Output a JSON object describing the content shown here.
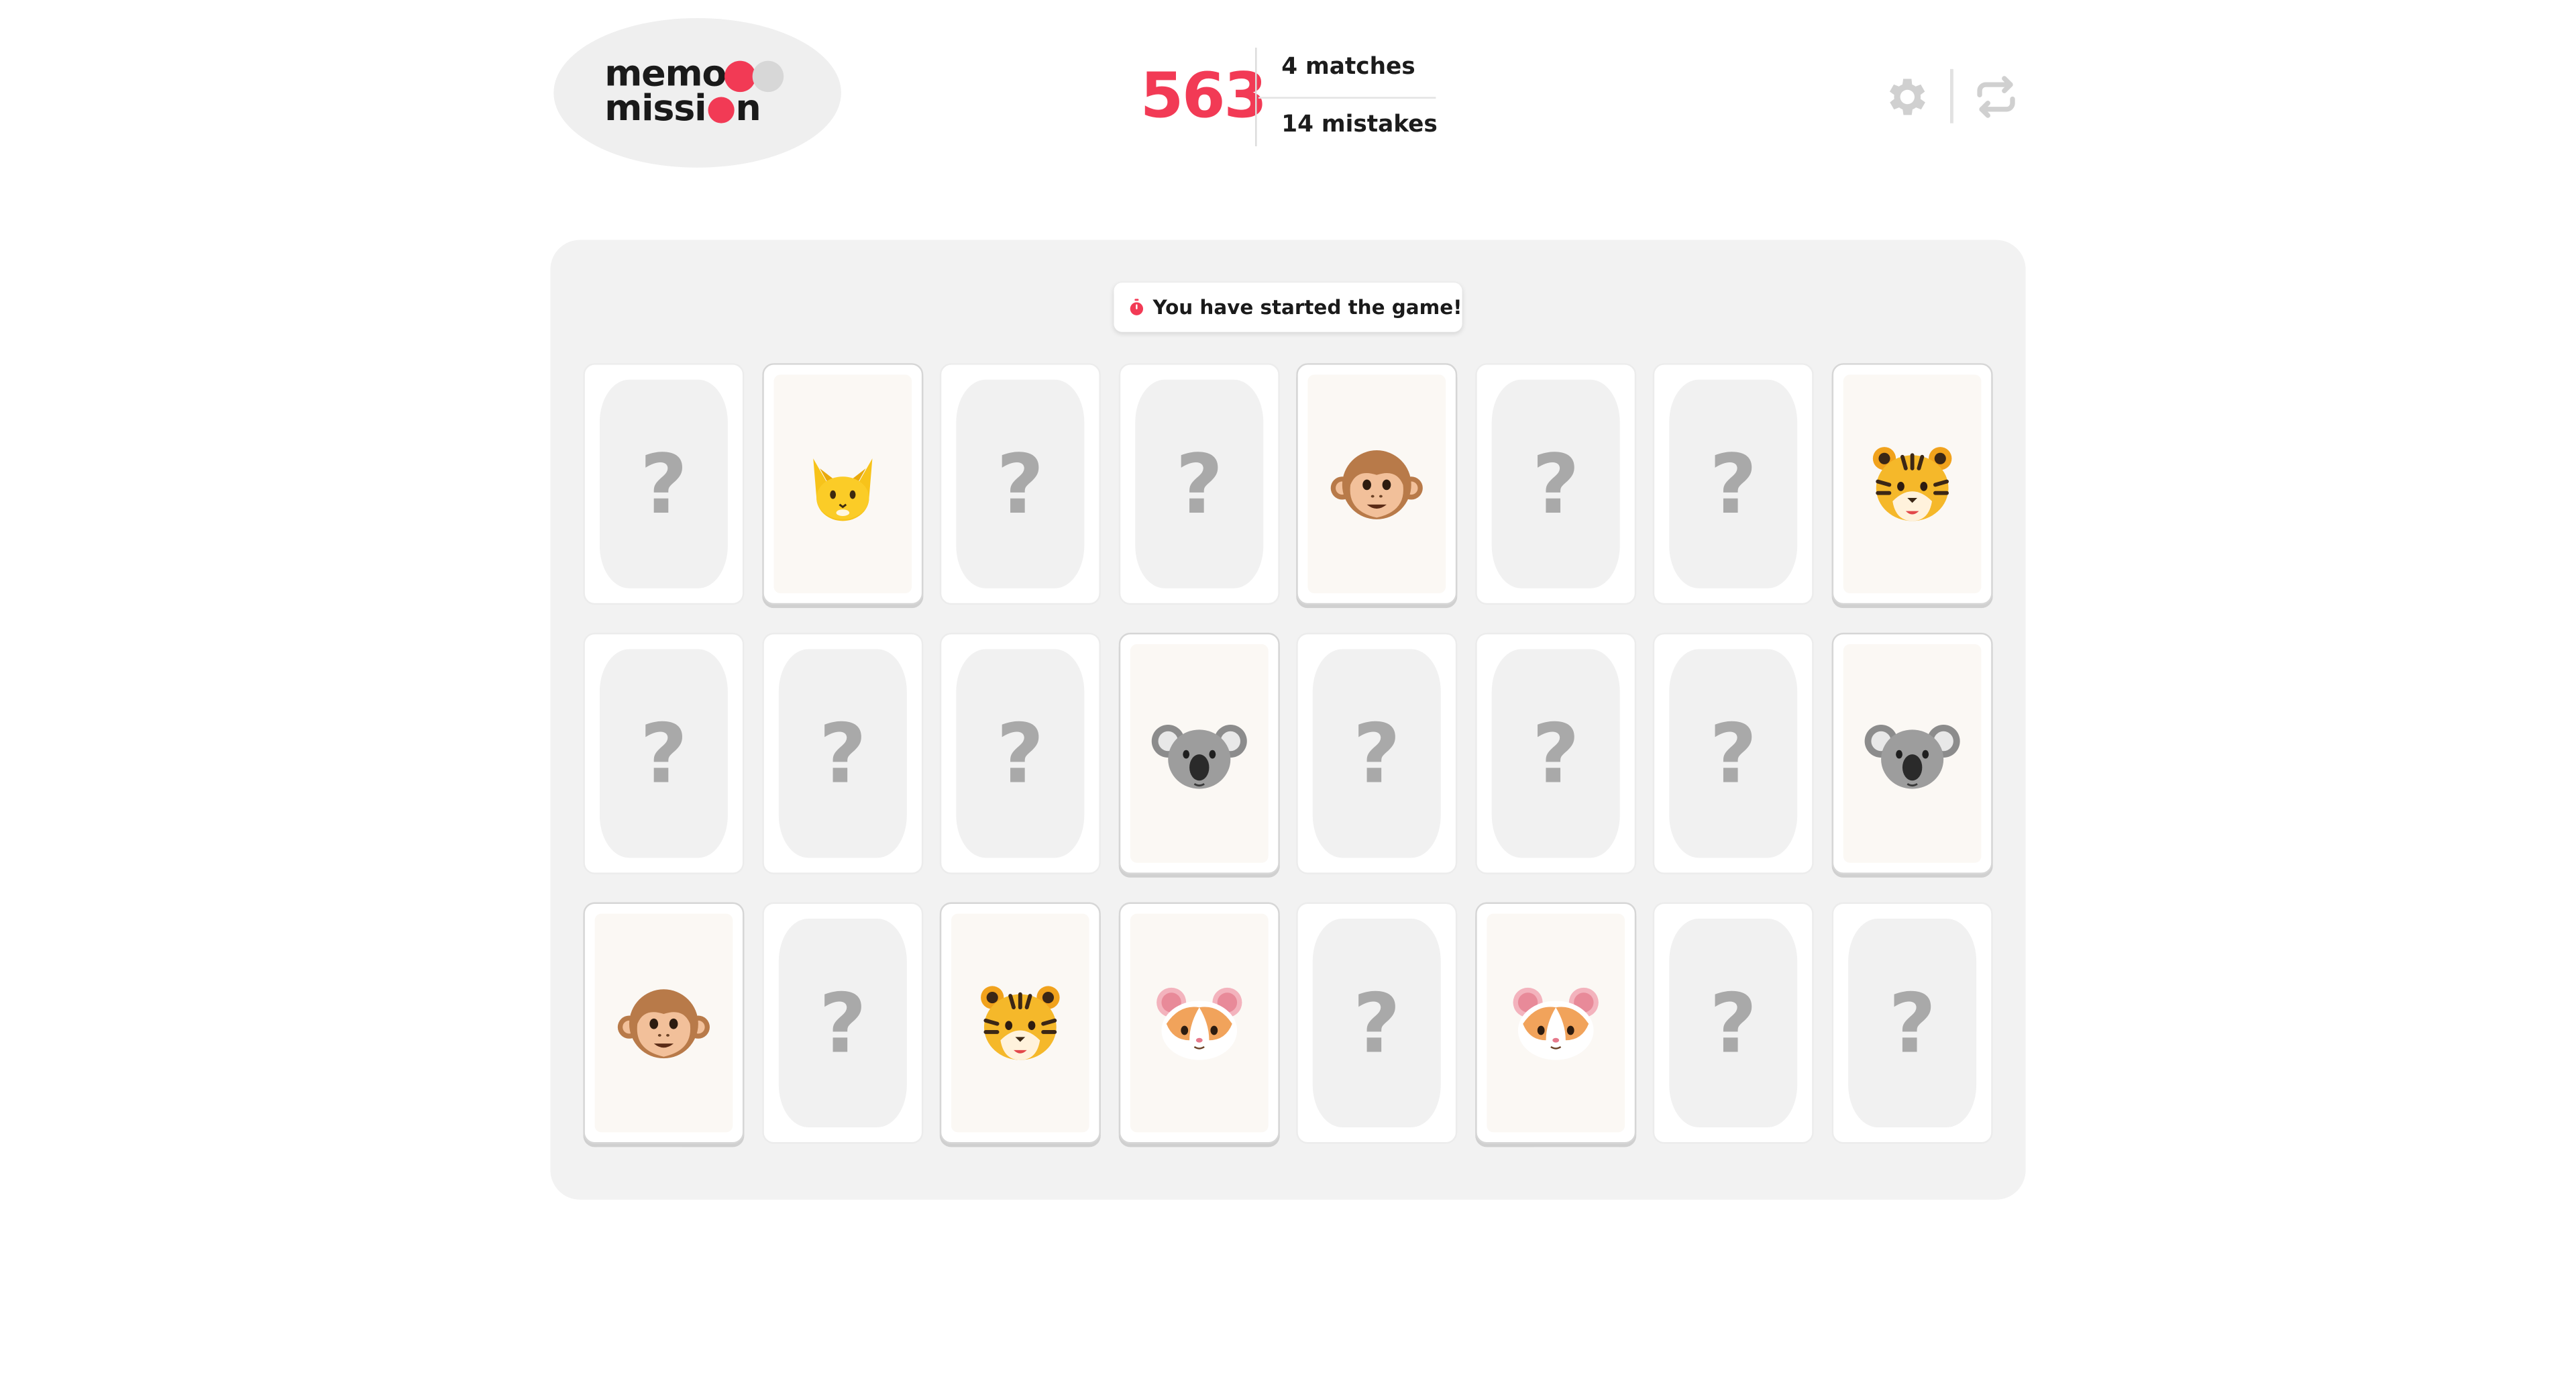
{
  "logo": {
    "line1": "memo",
    "line2": "missi",
    "line2_end": "n"
  },
  "header": {
    "score": "563",
    "matches": "4 matches",
    "mistakes": "14 mistakes"
  },
  "toolbar": {
    "settings_icon": "gear-icon",
    "restart_icon": "restart-icon"
  },
  "toast": {
    "icon": "stopwatch-icon",
    "message": "You have started the game!"
  },
  "colors": {
    "accent": "#f23a55",
    "dot_grey": "#d7d7d7",
    "board": "#f2f2f2"
  },
  "cards": {
    "hidden_symbol": "?",
    "rows": [
      [
        "hidden",
        "cat",
        "hidden",
        "hidden",
        "monkey",
        "hidden",
        "hidden",
        "tiger"
      ],
      [
        "hidden",
        "hidden",
        "hidden",
        "koala",
        "hidden",
        "hidden",
        "hidden",
        "koala"
      ],
      [
        "monkey",
        "hidden",
        "tiger",
        "hamster",
        "hidden",
        "hamster",
        "hidden",
        "hidden"
      ]
    ]
  }
}
